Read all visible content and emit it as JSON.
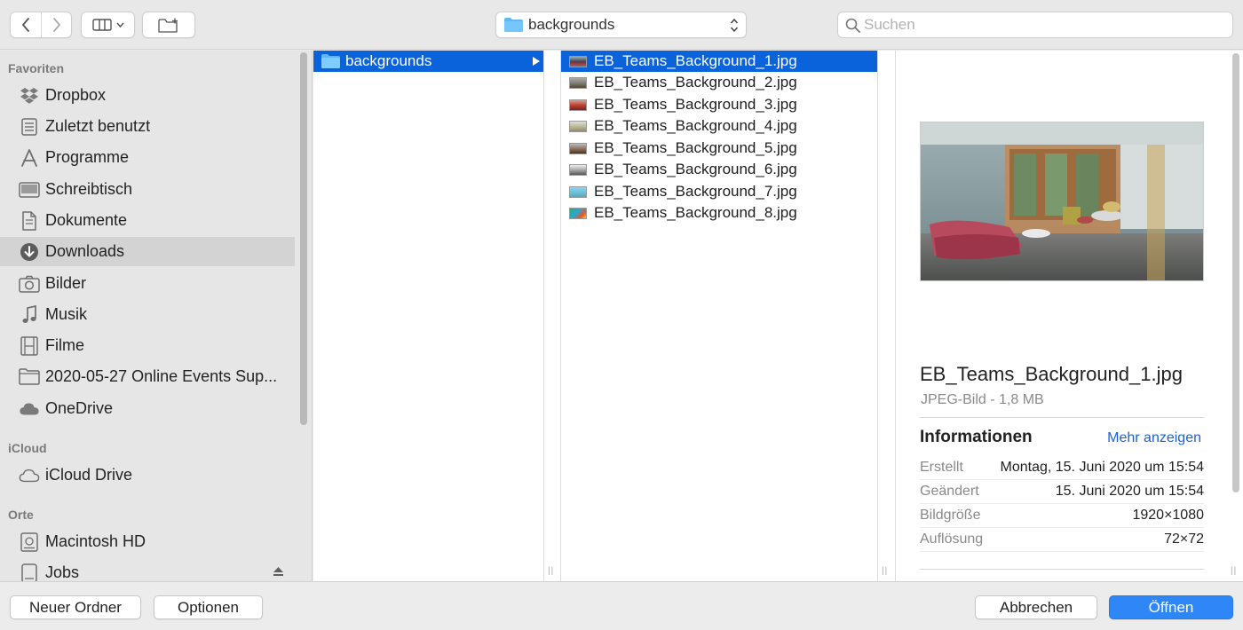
{
  "toolbar": {
    "path_label": "backgrounds",
    "search_placeholder": "Suchen"
  },
  "sidebar": {
    "sections": [
      {
        "label": "Favoriten"
      },
      {
        "label": "iCloud"
      },
      {
        "label": "Orte"
      }
    ],
    "favorites": [
      {
        "label": "Dropbox",
        "icon": "dropbox-icon"
      },
      {
        "label": "Zuletzt benutzt",
        "icon": "recents-icon"
      },
      {
        "label": "Programme",
        "icon": "applications-icon"
      },
      {
        "label": "Schreibtisch",
        "icon": "desktop-icon"
      },
      {
        "label": "Dokumente",
        "icon": "documents-icon"
      },
      {
        "label": "Downloads",
        "icon": "downloads-icon",
        "selected": true
      },
      {
        "label": "Bilder",
        "icon": "camera-icon"
      },
      {
        "label": "Musik",
        "icon": "music-note-icon"
      },
      {
        "label": "Filme",
        "icon": "film-icon"
      },
      {
        "label": "2020-05-27 Online Events Sup...",
        "icon": "folder-icon"
      },
      {
        "label": "OneDrive",
        "icon": "cloud-icon"
      }
    ],
    "icloud": [
      {
        "label": "iCloud Drive",
        "icon": "cloud-icon"
      }
    ],
    "places": [
      {
        "label": "Macintosh HD",
        "icon": "hard-drive-icon"
      },
      {
        "label": "Jobs",
        "icon": "external-drive-icon"
      }
    ]
  },
  "column1": {
    "items": [
      {
        "label": "backgrounds",
        "selected": true
      }
    ]
  },
  "column2": {
    "items": [
      {
        "label": "EB_Teams_Background_1.jpg",
        "selected": true
      },
      {
        "label": "EB_Teams_Background_2.jpg"
      },
      {
        "label": "EB_Teams_Background_3.jpg"
      },
      {
        "label": "EB_Teams_Background_4.jpg"
      },
      {
        "label": "EB_Teams_Background_5.jpg"
      },
      {
        "label": "EB_Teams_Background_6.jpg"
      },
      {
        "label": "EB_Teams_Background_7.jpg"
      },
      {
        "label": "EB_Teams_Background_8.jpg"
      }
    ]
  },
  "preview": {
    "filename": "EB_Teams_Background_1.jpg",
    "type_size": "JPEG-Bild - 1,8 MB",
    "info_title": "Informationen",
    "more_link": "Mehr anzeigen",
    "rows": [
      {
        "key": "Erstellt",
        "value": "Montag, 15. Juni 2020 um 15:54"
      },
      {
        "key": "Geändert",
        "value": "15. Juni 2020 um 15:54"
      },
      {
        "key": "Bildgröße",
        "value": "1920×1080"
      },
      {
        "key": "Auflösung",
        "value": "72×72"
      }
    ]
  },
  "bottom": {
    "new_folder": "Neuer Ordner",
    "options": "Optionen",
    "cancel": "Abbrechen",
    "open": "Öffnen"
  },
  "colors": {
    "selection": "#0b63db",
    "primary_button": "#2f86f6",
    "link": "#1a62d6"
  }
}
